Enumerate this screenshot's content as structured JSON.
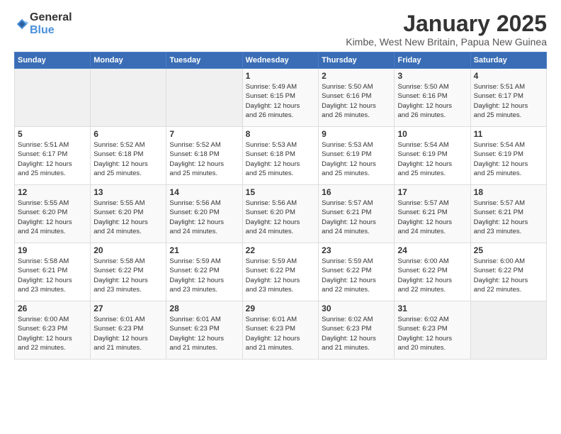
{
  "logo": {
    "text_general": "General",
    "text_blue": "Blue"
  },
  "title": {
    "month_year": "January 2025",
    "location": "Kimbe, West New Britain, Papua New Guinea"
  },
  "weekdays": [
    "Sunday",
    "Monday",
    "Tuesday",
    "Wednesday",
    "Thursday",
    "Friday",
    "Saturday"
  ],
  "weeks": [
    [
      {
        "day": "",
        "info": ""
      },
      {
        "day": "",
        "info": ""
      },
      {
        "day": "",
        "info": ""
      },
      {
        "day": "1",
        "info": "Sunrise: 5:49 AM\nSunset: 6:15 PM\nDaylight: 12 hours\nand 26 minutes."
      },
      {
        "day": "2",
        "info": "Sunrise: 5:50 AM\nSunset: 6:16 PM\nDaylight: 12 hours\nand 26 minutes."
      },
      {
        "day": "3",
        "info": "Sunrise: 5:50 AM\nSunset: 6:16 PM\nDaylight: 12 hours\nand 26 minutes."
      },
      {
        "day": "4",
        "info": "Sunrise: 5:51 AM\nSunset: 6:17 PM\nDaylight: 12 hours\nand 25 minutes."
      }
    ],
    [
      {
        "day": "5",
        "info": "Sunrise: 5:51 AM\nSunset: 6:17 PM\nDaylight: 12 hours\nand 25 minutes."
      },
      {
        "day": "6",
        "info": "Sunrise: 5:52 AM\nSunset: 6:18 PM\nDaylight: 12 hours\nand 25 minutes."
      },
      {
        "day": "7",
        "info": "Sunrise: 5:52 AM\nSunset: 6:18 PM\nDaylight: 12 hours\nand 25 minutes."
      },
      {
        "day": "8",
        "info": "Sunrise: 5:53 AM\nSunset: 6:18 PM\nDaylight: 12 hours\nand 25 minutes."
      },
      {
        "day": "9",
        "info": "Sunrise: 5:53 AM\nSunset: 6:19 PM\nDaylight: 12 hours\nand 25 minutes."
      },
      {
        "day": "10",
        "info": "Sunrise: 5:54 AM\nSunset: 6:19 PM\nDaylight: 12 hours\nand 25 minutes."
      },
      {
        "day": "11",
        "info": "Sunrise: 5:54 AM\nSunset: 6:19 PM\nDaylight: 12 hours\nand 25 minutes."
      }
    ],
    [
      {
        "day": "12",
        "info": "Sunrise: 5:55 AM\nSunset: 6:20 PM\nDaylight: 12 hours\nand 24 minutes."
      },
      {
        "day": "13",
        "info": "Sunrise: 5:55 AM\nSunset: 6:20 PM\nDaylight: 12 hours\nand 24 minutes."
      },
      {
        "day": "14",
        "info": "Sunrise: 5:56 AM\nSunset: 6:20 PM\nDaylight: 12 hours\nand 24 minutes."
      },
      {
        "day": "15",
        "info": "Sunrise: 5:56 AM\nSunset: 6:20 PM\nDaylight: 12 hours\nand 24 minutes."
      },
      {
        "day": "16",
        "info": "Sunrise: 5:57 AM\nSunset: 6:21 PM\nDaylight: 12 hours\nand 24 minutes."
      },
      {
        "day": "17",
        "info": "Sunrise: 5:57 AM\nSunset: 6:21 PM\nDaylight: 12 hours\nand 24 minutes."
      },
      {
        "day": "18",
        "info": "Sunrise: 5:57 AM\nSunset: 6:21 PM\nDaylight: 12 hours\nand 23 minutes."
      }
    ],
    [
      {
        "day": "19",
        "info": "Sunrise: 5:58 AM\nSunset: 6:21 PM\nDaylight: 12 hours\nand 23 minutes."
      },
      {
        "day": "20",
        "info": "Sunrise: 5:58 AM\nSunset: 6:22 PM\nDaylight: 12 hours\nand 23 minutes."
      },
      {
        "day": "21",
        "info": "Sunrise: 5:59 AM\nSunset: 6:22 PM\nDaylight: 12 hours\nand 23 minutes."
      },
      {
        "day": "22",
        "info": "Sunrise: 5:59 AM\nSunset: 6:22 PM\nDaylight: 12 hours\nand 23 minutes."
      },
      {
        "day": "23",
        "info": "Sunrise: 5:59 AM\nSunset: 6:22 PM\nDaylight: 12 hours\nand 22 minutes."
      },
      {
        "day": "24",
        "info": "Sunrise: 6:00 AM\nSunset: 6:22 PM\nDaylight: 12 hours\nand 22 minutes."
      },
      {
        "day": "25",
        "info": "Sunrise: 6:00 AM\nSunset: 6:22 PM\nDaylight: 12 hours\nand 22 minutes."
      }
    ],
    [
      {
        "day": "26",
        "info": "Sunrise: 6:00 AM\nSunset: 6:23 PM\nDaylight: 12 hours\nand 22 minutes."
      },
      {
        "day": "27",
        "info": "Sunrise: 6:01 AM\nSunset: 6:23 PM\nDaylight: 12 hours\nand 21 minutes."
      },
      {
        "day": "28",
        "info": "Sunrise: 6:01 AM\nSunset: 6:23 PM\nDaylight: 12 hours\nand 21 minutes."
      },
      {
        "day": "29",
        "info": "Sunrise: 6:01 AM\nSunset: 6:23 PM\nDaylight: 12 hours\nand 21 minutes."
      },
      {
        "day": "30",
        "info": "Sunrise: 6:02 AM\nSunset: 6:23 PM\nDaylight: 12 hours\nand 21 minutes."
      },
      {
        "day": "31",
        "info": "Sunrise: 6:02 AM\nSunset: 6:23 PM\nDaylight: 12 hours\nand 20 minutes."
      },
      {
        "day": "",
        "info": ""
      }
    ]
  ]
}
